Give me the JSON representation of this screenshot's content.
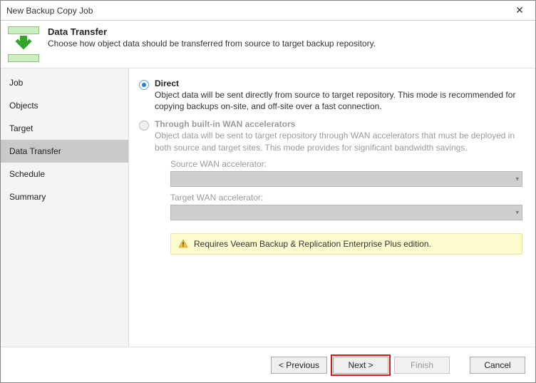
{
  "window": {
    "title": "New Backup Copy Job"
  },
  "header": {
    "title": "Data Transfer",
    "subtitle": "Choose how object data should be transferred from source to target backup repository."
  },
  "sidebar": {
    "items": [
      {
        "label": "Job"
      },
      {
        "label": "Objects"
      },
      {
        "label": "Target"
      },
      {
        "label": "Data Transfer"
      },
      {
        "label": "Schedule"
      },
      {
        "label": "Summary"
      }
    ],
    "active_index": 3
  },
  "options": {
    "direct": {
      "title": "Direct",
      "desc": "Object data will be sent directly from source to target repository. This mode is recommended for copying backups on-site, and off-site over a fast connection.",
      "checked": true
    },
    "wan": {
      "title": "Through built-in WAN accelerators",
      "desc": "Object data will be sent to target repository through WAN accelerators that must be deployed in both source and target sites. This mode provides for significant bandwidth savings.",
      "source_label": "Source WAN accelerator:",
      "target_label": "Target WAN accelerator:"
    }
  },
  "warning": {
    "text": "Requires Veeam Backup & Replication Enterprise Plus edition."
  },
  "footer": {
    "previous": "< Previous",
    "next": "Next >",
    "finish": "Finish",
    "cancel": "Cancel"
  }
}
